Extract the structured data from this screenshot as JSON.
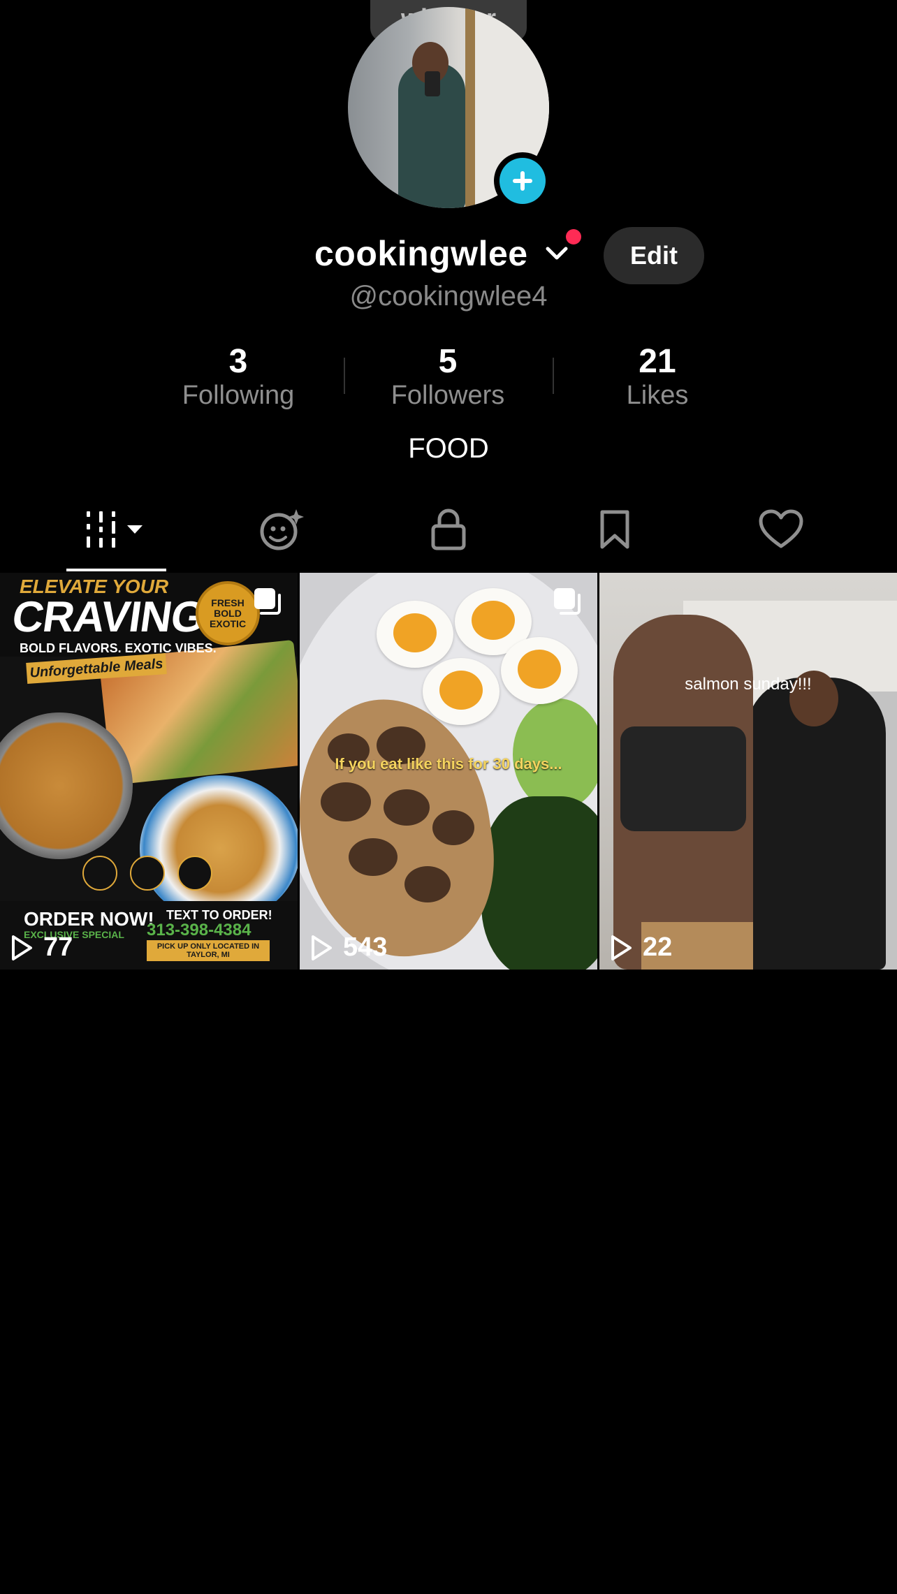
{
  "whisper": {
    "label": "whisper"
  },
  "profile": {
    "username": "cookingwlee",
    "handle": "@cookingwlee4",
    "edit_label": "Edit",
    "bio": "FOOD"
  },
  "stats": [
    {
      "value": "3",
      "label": "Following"
    },
    {
      "value": "5",
      "label": "Followers"
    },
    {
      "value": "21",
      "label": "Likes"
    }
  ],
  "tabs": [
    {
      "icon": "grid-videos-icon",
      "active": true
    },
    {
      "icon": "ai-self-icon",
      "active": false
    },
    {
      "icon": "lock-icon",
      "active": false
    },
    {
      "icon": "bookmark-icon",
      "active": false
    },
    {
      "icon": "heart-icon",
      "active": false
    }
  ],
  "videos": [
    {
      "views": "77",
      "multi": true,
      "flyer": {
        "elevate": "ELEVATE YOUR",
        "cravings": "CRAVINGS!",
        "tagline": "BOLD FLAVORS. EXOTIC VIBES.",
        "meals": "Unforgettable Meals",
        "seal": [
          "FRESH",
          "BOLD",
          "EXOTIC"
        ],
        "order": "ORDER NOW!",
        "special": "EXCLUSIVE SPECIAL",
        "text_to_order": "TEXT TO ORDER!",
        "phone": "313-398-4384",
        "pickup": "PICK UP ONLY LOCATED IN TAYLOR, MI"
      }
    },
    {
      "views": "543",
      "multi": true,
      "caption": "If you eat like this for 30 days..."
    },
    {
      "views": "22",
      "multi": false,
      "caption": "salmon sunday!!!"
    }
  ],
  "colors": {
    "background": "#000000",
    "accent_blue": "#20bde0",
    "notification_red": "#ff2b55",
    "secondary_text": "#8f8f8f"
  }
}
